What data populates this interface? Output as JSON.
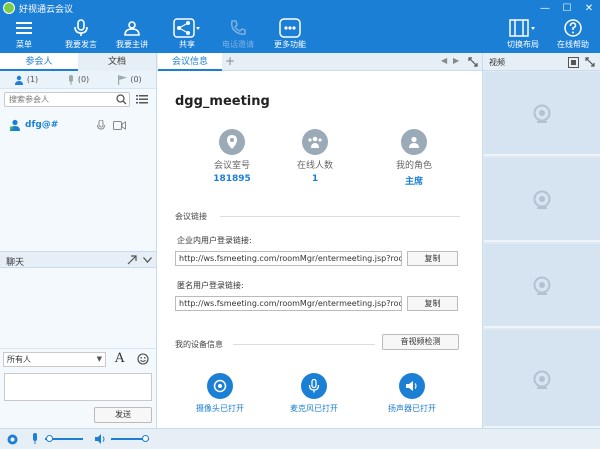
{
  "app": {
    "title": "好视通云会议"
  },
  "toolbar": {
    "menu": "菜单",
    "speak": "我要发言",
    "host": "我要主讲",
    "share": "共享",
    "phone_invite": "电话邀请",
    "more": "更多功能",
    "layout": "切换布局",
    "help": "在线帮助"
  },
  "left": {
    "tabs": {
      "participants": "参会人",
      "documents": "文档"
    },
    "counts": {
      "users": "(1)",
      "mic": "(0)",
      "flag": "(0)"
    },
    "search": {
      "placeholder": "搜索参会人"
    },
    "user": {
      "name": "dfg@#"
    },
    "chat": {
      "title": "聊天",
      "recipient": "所有人",
      "send": "发送"
    }
  },
  "center": {
    "tab": "会议信息",
    "meeting_title": "dgg_meeting",
    "stats": {
      "room_label": "会议室号",
      "room_value": "181895",
      "online_label": "在线人数",
      "online_value": "1",
      "role_label": "我的角色",
      "role_value": "主席"
    },
    "links": {
      "section": "会议链接",
      "internal_label": "企业内用户登录链接:",
      "internal_url": "http://ws.fsmeeting.com/roomMgr/entermeeting.jsp?roo...",
      "anonymous_label": "匿名用户登录链接:",
      "anonymous_url": "http://ws.fsmeeting.com/roomMgr/entermeeting.jsp?roo...",
      "copy": "复制"
    },
    "devices": {
      "section": "我的设备信息",
      "check_button": "音视频检测",
      "camera": "摄像头已打开",
      "microphone": "麦克风已打开",
      "speaker": "扬声器已打开"
    }
  },
  "right": {
    "title": "视频"
  },
  "colors": {
    "accent": "#1c7fd6",
    "panel": "#e6eef6"
  }
}
